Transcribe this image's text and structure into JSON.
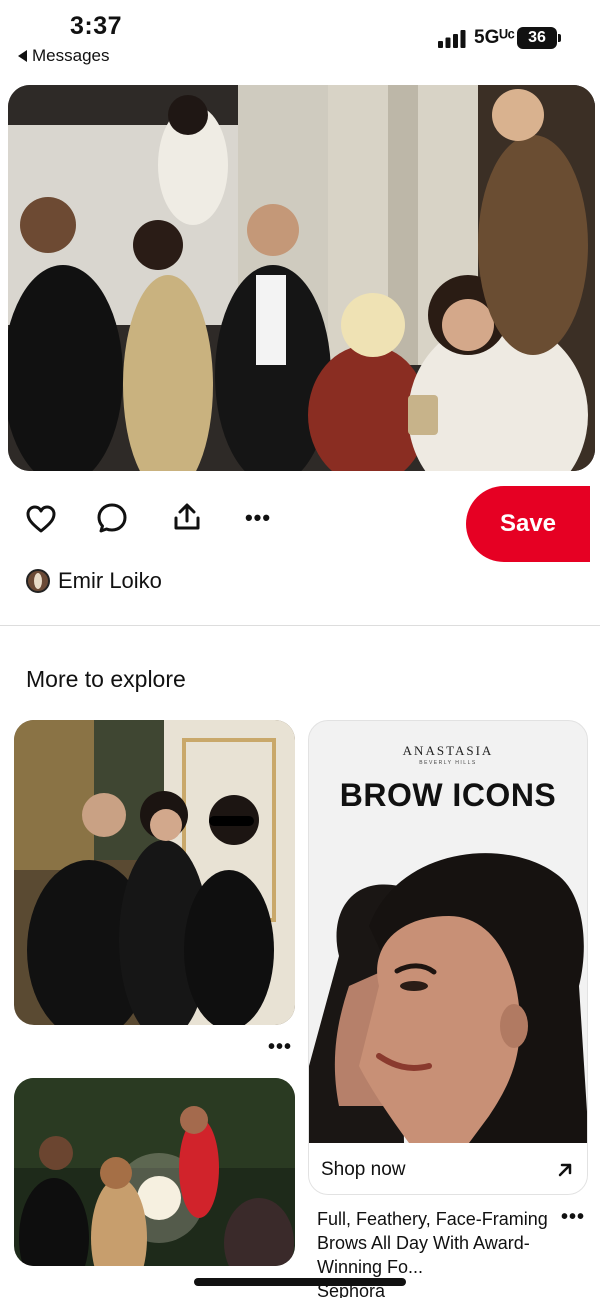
{
  "status_bar": {
    "time": "3:37",
    "back_label": "Messages",
    "network": "5Gᵁᶜ",
    "battery": "36"
  },
  "hero": {
    "icon": "photo"
  },
  "actions": {
    "like_icon": "heart-outline-icon",
    "comment_icon": "chat-bubble-icon",
    "share_icon": "share-upload-icon",
    "more_icon": "more-dots-icon",
    "more_label": "•••",
    "save_label": "Save"
  },
  "author": {
    "name": "Emir Loiko"
  },
  "explore": {
    "title": "More to explore",
    "pins": [
      {
        "more_label": "•••"
      },
      {
        "more_label": ""
      }
    ],
    "ad": {
      "brand": "ANASTASIA",
      "brand_sub": "BEVERLY HILLS",
      "headline": "BROW ICONS",
      "cta": "Shop now",
      "description": "Full, Feathery, Face-Framing Brows All Day With Award-Winning Fo...",
      "source": "Sephora",
      "more_label": "•••"
    }
  },
  "colors": {
    "save": "#e60023",
    "text": "#111111"
  }
}
